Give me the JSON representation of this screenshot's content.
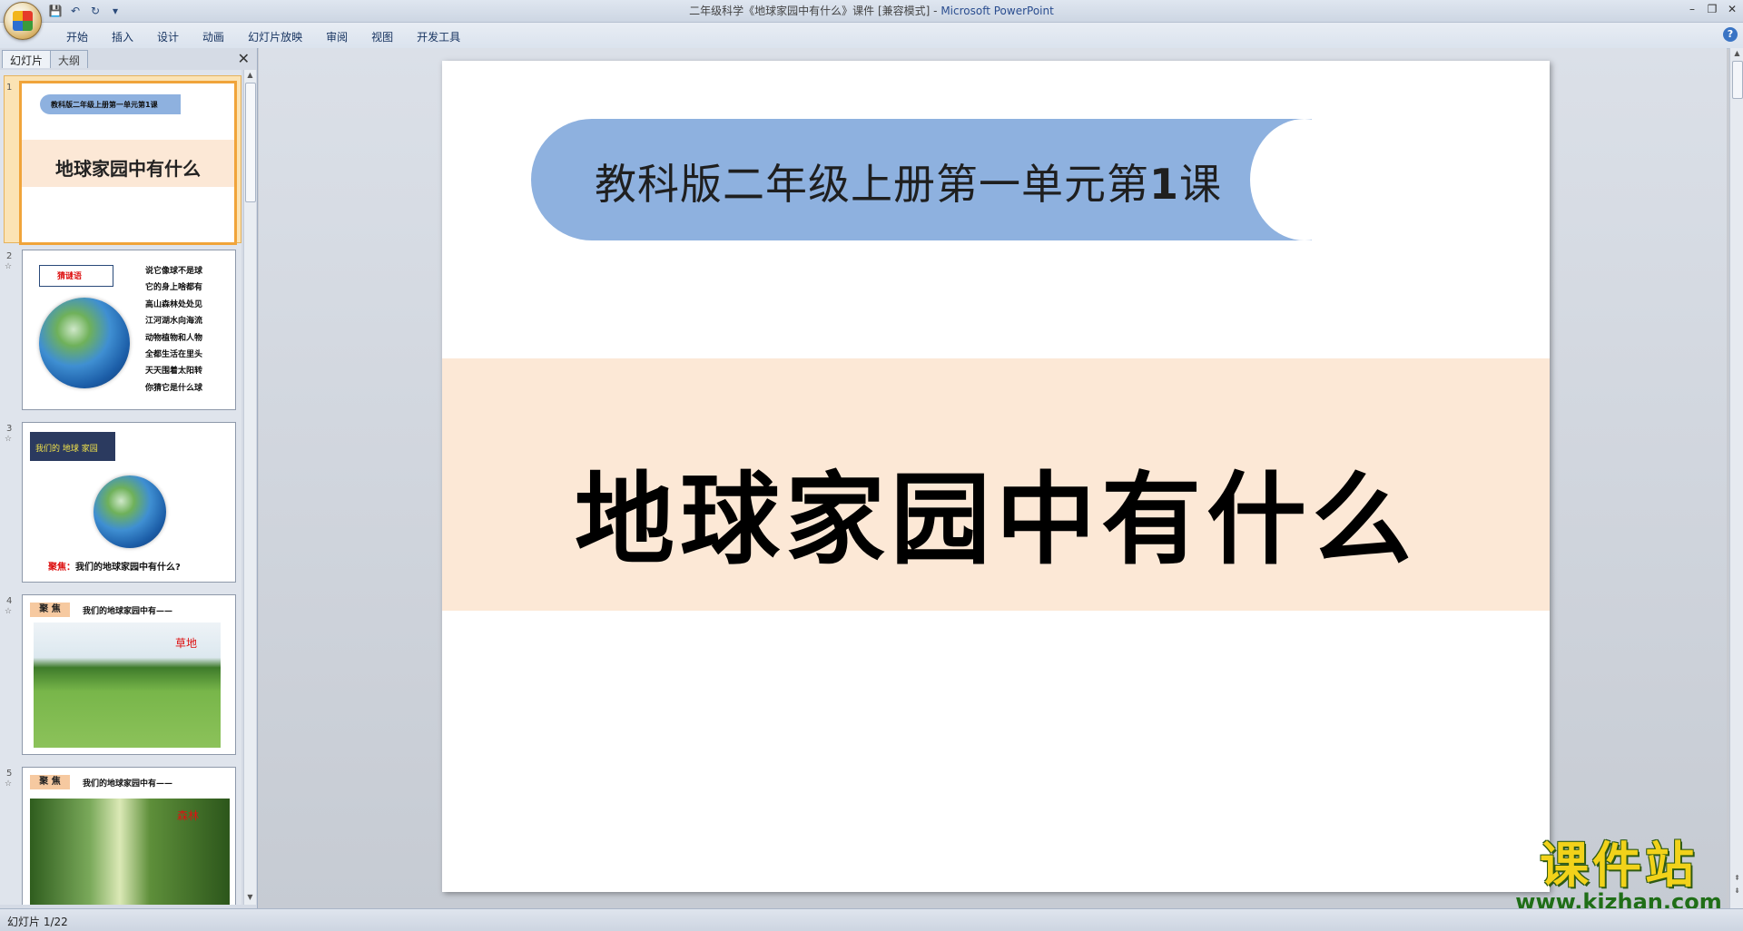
{
  "window": {
    "title_doc": "二年级科学《地球家园中有什么》课件 [兼容模式] - ",
    "title_app": "Microsoft PowerPoint"
  },
  "ribbon": {
    "tabs": [
      "开始",
      "插入",
      "设计",
      "动画",
      "幻灯片放映",
      "审阅",
      "视图",
      "开发工具"
    ]
  },
  "left_pane": {
    "tab_slides": "幻灯片",
    "tab_outline": "大纲",
    "thumbnails": [
      {
        "num": "1",
        "banner": "教科版二年级上册第一单元第1课",
        "title": "地球家园中有什么"
      },
      {
        "num": "2",
        "ribbon": "猜谜语",
        "poem": [
          "说它像球不是球",
          "它的身上啥都有",
          "高山森林处处见",
          "江河湖水向海流",
          "动物植物和人物",
          "全都生活在里头",
          "天天围着太阳转",
          "你猜它是什么球"
        ]
      },
      {
        "num": "3",
        "tag": "我们的 地球 家园",
        "caption_red": "聚焦：",
        "caption": "我们的地球家园中有什么?"
      },
      {
        "num": "4",
        "tag": "聚 焦",
        "head": "我们的地球家园中有——",
        "label": "草地"
      },
      {
        "num": "5",
        "tag": "聚 焦",
        "head": "我们的地球家园中有——",
        "label": "森林"
      }
    ]
  },
  "slide": {
    "banner_text": "教科版二年级上册第一单元第",
    "banner_num": "1",
    "banner_suffix": "课",
    "title": "地球家园中有什么"
  },
  "status": {
    "slide_count": "幻灯片 1/22"
  },
  "watermark": {
    "cn": "课件站",
    "url": "www.kjzhan.com"
  },
  "colors": {
    "banner": "#8eb1df",
    "band": "#fce8d6",
    "selection": "#f0a43a"
  }
}
